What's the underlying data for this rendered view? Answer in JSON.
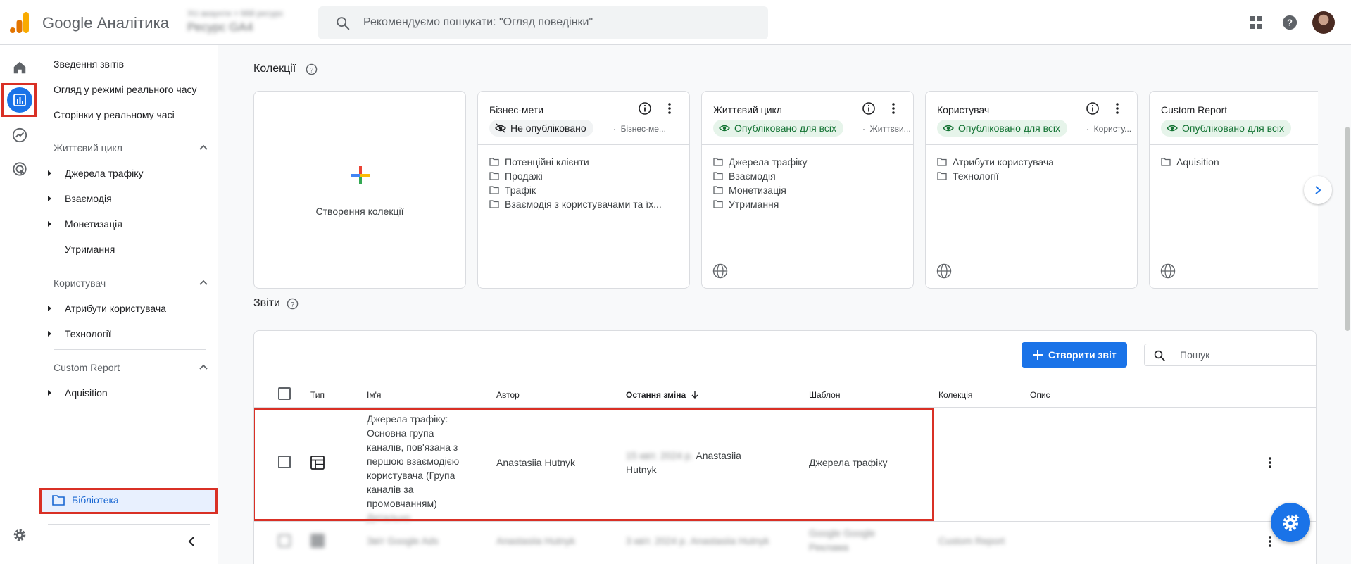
{
  "header": {
    "app_title": "Google Аналітика",
    "account_line1": "Усі акаунти > Мій ресурс",
    "account_line2": "Ресурс GA4",
    "search_placeholder": "Рекомендуємо пошукати: \"Огляд поведінки\""
  },
  "rail": {
    "items": [
      "home-icon",
      "reports-icon",
      "explore-icon",
      "advertising-icon",
      "admin-gear-icon"
    ]
  },
  "sidenav": {
    "top_items": [
      "Зведення звітів",
      "Огляд у режимі реального часу",
      "Сторінки у реальному часі"
    ],
    "sections": [
      {
        "title": "Життєвий цикл",
        "items": [
          {
            "label": "Джерела трафіку",
            "expandable": true
          },
          {
            "label": "Взаємодія",
            "expandable": true
          },
          {
            "label": "Монетизація",
            "expandable": true
          },
          {
            "label": "Утримання",
            "expandable": false
          }
        ]
      },
      {
        "title": "Користувач",
        "items": [
          {
            "label": "Атрибути користувача",
            "expandable": true
          },
          {
            "label": "Технології",
            "expandable": true
          }
        ]
      },
      {
        "title": "Custom Report",
        "items": [
          {
            "label": "Aquisition",
            "expandable": true
          }
        ]
      }
    ],
    "library_label": "Бібліотека"
  },
  "collections": {
    "title": "Колекції",
    "create_label": "Створення колекції",
    "cards": [
      {
        "title": "Бізнес-мети",
        "status": "Не опубліковано",
        "published": false,
        "template": "Бізнес-ме...",
        "folders": [
          "Потенційні клієнти",
          "Продажі",
          "Трафік",
          "Взаємодія з користувачами та їх..."
        ]
      },
      {
        "title": "Життєвий цикл",
        "status": "Опубліковано для всіх",
        "published": true,
        "template": "Життєви...",
        "folders": [
          "Джерела трафіку",
          "Взаємодія",
          "Монетизація",
          "Утримання"
        ]
      },
      {
        "title": "Користувач",
        "status": "Опубліковано для всіх",
        "published": true,
        "template": "Користу...",
        "folders": [
          "Атрибути користувача",
          "Технології"
        ]
      },
      {
        "title": "Custom Report",
        "status": "Опубліковано для всіх",
        "published": true,
        "template": "",
        "folders": [
          "Aquisition"
        ]
      }
    ]
  },
  "reports": {
    "title": "Звіти",
    "create_button": "Створити звіт",
    "search_placeholder": "Пошук",
    "columns": {
      "type": "Тип",
      "name": "Ім'я",
      "author": "Автор",
      "last_modified": "Остання зміна",
      "template": "Шаблон",
      "collection": "Колекція",
      "description": "Опис"
    },
    "rows": [
      {
        "name": "Джерела трафіку: Основна група каналів, пов'язана з першою взаємодією користувача (Група каналів за промовчанням)",
        "name_extra": "Детально",
        "author": "Anastasiia Hutnyk",
        "modified_date": "15 квіт. 2024 р.",
        "modified_by": "Anastasiia Hutnyk",
        "template": "Джерела трафіку",
        "collection": "",
        "description": ""
      },
      {
        "name": "Звіт Google Ads",
        "author": "Anastasiia Hutnyk",
        "modified_date": "3 квіт. 2024 р.",
        "modified_by": "Anastasiia Hutnyk",
        "template": "Google Google Реклама",
        "collection": "Custom Report",
        "description": ""
      }
    ]
  },
  "colors": {
    "accent": "#1a73e8",
    "highlight": "#d93025",
    "published": "#137333"
  }
}
